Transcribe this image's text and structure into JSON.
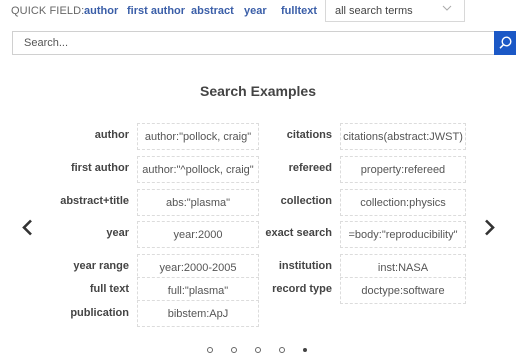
{
  "quick_field": {
    "label": "QUICK FIELD:",
    "links": [
      "author",
      "first author",
      "abstract",
      "year",
      "fulltext"
    ],
    "select_value": "all search terms"
  },
  "search": {
    "placeholder": "Search..."
  },
  "examples": {
    "title": "Search Examples",
    "left": [
      {
        "label": "author",
        "example": "author:\"pollock, craig\""
      },
      {
        "label": "first author",
        "example": "author:\"^pollock, craig\""
      },
      {
        "label": "abstract+title",
        "example": "abs:\"plasma\""
      },
      {
        "label": "year",
        "example": "year:2000"
      },
      {
        "label": "year range",
        "example": "year:2000-2005"
      },
      {
        "label": "full text",
        "example": "full:\"plasma\""
      },
      {
        "label": "publication",
        "example": "bibstem:ApJ"
      }
    ],
    "right": [
      {
        "label": "citations",
        "example": "citations(abstract:JWST)"
      },
      {
        "label": "refereed",
        "example": "property:refereed"
      },
      {
        "label": "collection",
        "example": "collection:physics"
      },
      {
        "label": "exact search",
        "example": "=body:\"reproducibility\""
      },
      {
        "label": "institution",
        "example": "inst:NASA"
      },
      {
        "label": "record type",
        "example": "doctype:software"
      }
    ]
  },
  "carousel": {
    "page_count": 5,
    "active_index": 4
  },
  "colors": {
    "link": "#3a5ea8",
    "search_button": "#1b58c6"
  },
  "icons": {
    "search": "search-icon",
    "prev": "chevron-left-icon",
    "next": "chevron-right-icon",
    "select": "chevron-down-icon"
  }
}
